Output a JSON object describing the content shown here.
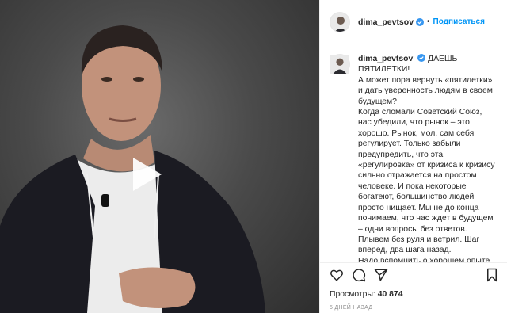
{
  "header": {
    "username": "dima_pevtsov",
    "separator": "•",
    "follow_label": "Подписаться"
  },
  "caption": {
    "username": "dima_pevtsov",
    "text_lines": [
      "ДАЕШЬ ПЯТИЛЕТКИ!",
      "А может пора вернуть «пятилетки» и дать уверенность людям в своем будущем?",
      "Когда сломали Советский Союз, нас убедили, что рынок – это хорошо. Рынок, мол, сам себя регулирует. Только забыли предупредить, что эта «регулировка» от кризиса к кризису сильно отражается на простом человеке. И пока некоторые богатеют, большинство людей просто нищает. Мы не до конца понимаем, что нас ждет в будущем – одни вопросы без ответов. Плывем без руля и ветрил. Шаг вперед, два шага назад.",
      "Надо вспомнить о хорошем опыте советских лет и применить его в"
    ]
  },
  "stats": {
    "views_label": "Просмотры:",
    "views_count": "40 874",
    "time_ago": "5 дней назад"
  },
  "colors": {
    "accent": "#0095f6",
    "verified": "#3897f0",
    "border": "#efefef",
    "muted": "#8e8e8e"
  },
  "icons": {
    "play": "play-icon",
    "like": "heart-icon",
    "comment": "comment-icon",
    "share": "share-icon",
    "save": "bookmark-icon",
    "verified": "verified-badge-icon"
  }
}
